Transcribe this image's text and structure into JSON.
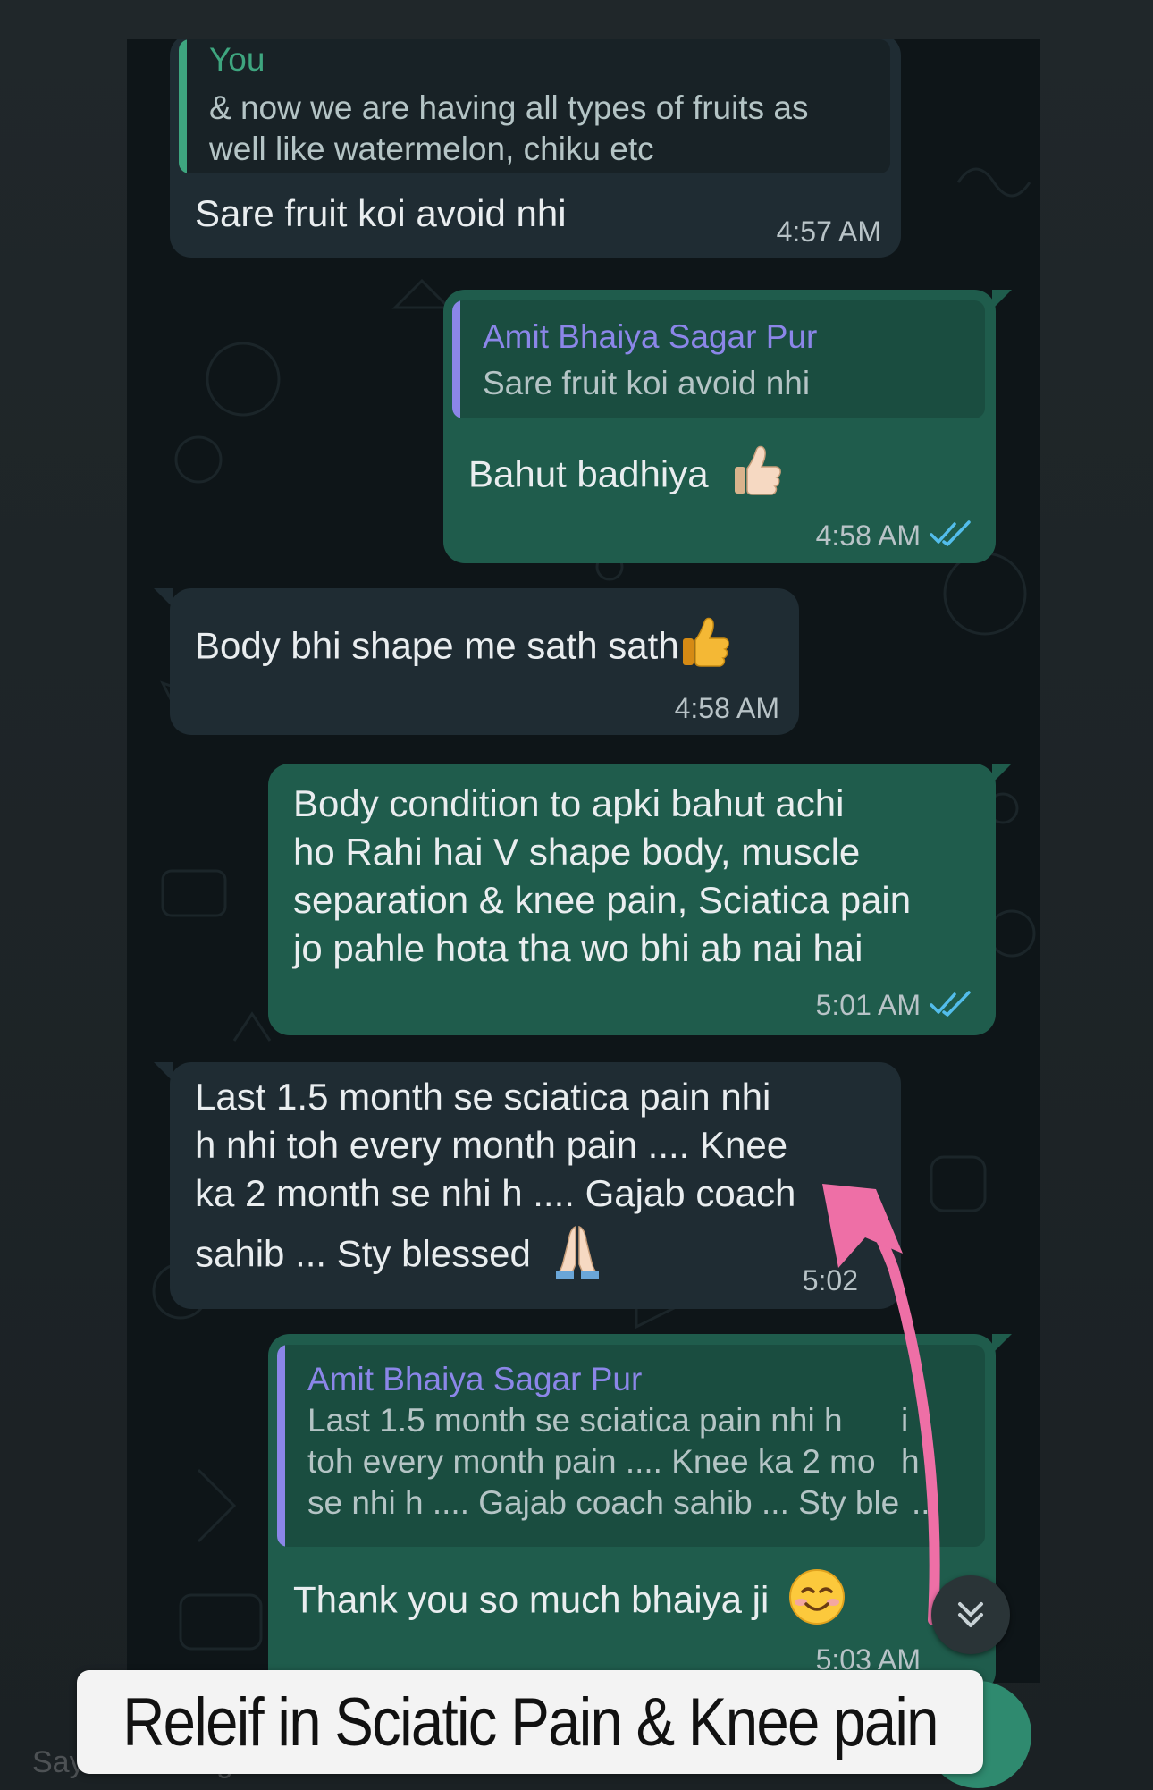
{
  "colors": {
    "incoming_bubble": "#1f2c33",
    "outgoing_bubble": "#1f5c4c",
    "you_quote_accent": "#3ea57f",
    "contact_quote_accent": "#8b86e8",
    "read_ticks": "#53bdeb",
    "annotation_arrow": "#ee6fa6"
  },
  "messages": [
    {
      "direction": "incoming",
      "quote": {
        "author": "You",
        "lines": [
          "& now we are having all types of fruits as",
          "well like watermelon, chiku etc"
        ]
      },
      "text": "Sare fruit koi avoid nhi",
      "time": "4:57 AM"
    },
    {
      "direction": "outgoing",
      "quote": {
        "author": "Amit Bhaiya Sagar Pur",
        "lines": [
          "Sare fruit koi avoid nhi"
        ]
      },
      "text": "Bahut badhiya",
      "emoji": "thumbs-up",
      "time": "4:58 AM",
      "status": "read"
    },
    {
      "direction": "incoming",
      "text": "Body bhi shape me sath sath",
      "emoji": "thumbs-up",
      "time": "4:58 AM"
    },
    {
      "direction": "outgoing",
      "lines": [
        "Body condition to apki bahut achi",
        "ho Rahi hai V shape body, muscle",
        "separation & knee pain, Sciatica pain",
        "jo pahle hota tha wo bhi ab nai hai"
      ],
      "time": "5:01 AM",
      "status": "read"
    },
    {
      "direction": "incoming",
      "lines": [
        "Last 1.5 month se sciatica pain nhi",
        "h nhi toh every month pain .... Knee",
        "ka 2 month se nhi h .... Gajab coach",
        "sahib ... Sty blessed"
      ],
      "emoji": "folded-hands",
      "time": "5:02"
    },
    {
      "direction": "outgoing",
      "quote": {
        "author": "Amit Bhaiya Sagar Pur",
        "lines": [
          "Last 1.5 month se sciatica pain nhi h",
          "toh every month pain .... Knee ka 2 mo",
          "se nhi h .... Gajab coach sahib ... Sty ble"
        ],
        "line_tails": [
          "i",
          "h",
          "..."
        ]
      },
      "text": "Thank you so much bhaiya ji",
      "emoji": "smiling-face",
      "time": "5:03 AM"
    }
  ],
  "scroll_button": {
    "icon": "double-chevron-down-icon"
  },
  "caption": "Releif in Sciatic Pain & Knee pain",
  "input_placeholder": "Say something..."
}
